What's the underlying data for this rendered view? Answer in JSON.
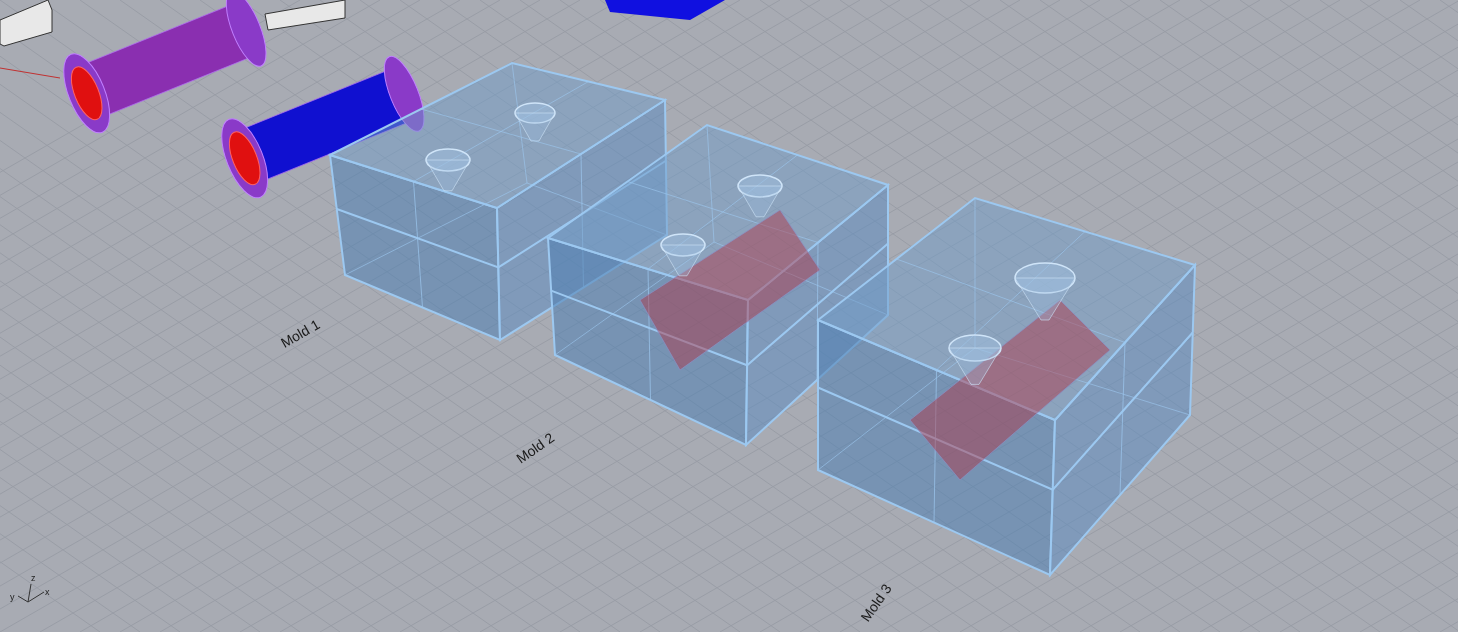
{
  "viewport": {
    "labels": [
      {
        "text": "Mold 1"
      },
      {
        "text": "Mold 2"
      },
      {
        "text": "Mold 3"
      }
    ],
    "axes": {
      "x": "x",
      "y": "y",
      "z": "z"
    }
  }
}
